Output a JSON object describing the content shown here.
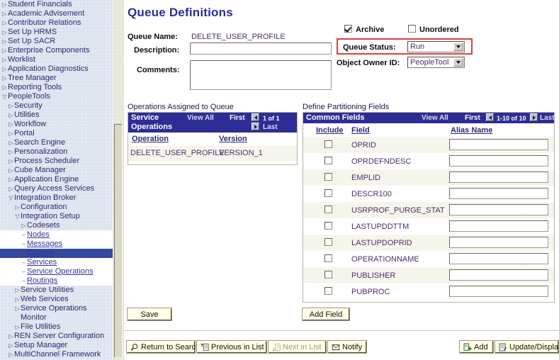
{
  "sidebar": {
    "items": [
      {
        "label": "Student Financials",
        "type": "collapsed",
        "indent": 0
      },
      {
        "label": "Academic Advisement",
        "type": "collapsed",
        "indent": 0
      },
      {
        "label": "Contributor Relations",
        "type": "collapsed",
        "indent": 0
      },
      {
        "label": "Set Up HRMS",
        "type": "collapsed",
        "indent": 0
      },
      {
        "label": "Set Up SACR",
        "type": "collapsed",
        "indent": 0
      },
      {
        "label": "Enterprise Components",
        "type": "collapsed",
        "indent": 0
      },
      {
        "label": "Worklist",
        "type": "collapsed",
        "indent": 0
      },
      {
        "label": "Application Diagnostics",
        "type": "collapsed",
        "indent": 0
      },
      {
        "label": "Tree Manager",
        "type": "collapsed",
        "indent": 0
      },
      {
        "label": "Reporting Tools",
        "type": "collapsed",
        "indent": 0
      },
      {
        "label": "PeopleTools",
        "type": "expanded",
        "indent": 0
      },
      {
        "label": "Security",
        "type": "collapsed",
        "indent": 1
      },
      {
        "label": "Utilities",
        "type": "collapsed",
        "indent": 1
      },
      {
        "label": "Workflow",
        "type": "collapsed",
        "indent": 1
      },
      {
        "label": "Portal",
        "type": "collapsed",
        "indent": 1
      },
      {
        "label": "Search Engine",
        "type": "collapsed",
        "indent": 1
      },
      {
        "label": "Personalization",
        "type": "collapsed",
        "indent": 1
      },
      {
        "label": "Process Scheduler",
        "type": "collapsed",
        "indent": 1
      },
      {
        "label": "Cube Manager",
        "type": "collapsed",
        "indent": 1
      },
      {
        "label": "Application Engine",
        "type": "collapsed",
        "indent": 1
      },
      {
        "label": "Query Access Services",
        "type": "collapsed",
        "indent": 1
      },
      {
        "label": "Integration Broker",
        "type": "expanded",
        "indent": 1
      },
      {
        "label": "Configuration",
        "type": "collapsed",
        "indent": 2
      },
      {
        "label": "Integration Setup",
        "type": "expanded",
        "indent": 2
      },
      {
        "label": "Codesets",
        "type": "collapsed",
        "indent": 3
      },
      {
        "label": "Nodes",
        "type": "link",
        "indent": 3
      },
      {
        "label": "Messages",
        "type": "link",
        "indent": 3
      },
      {
        "label": "Queues",
        "type": "link-selected",
        "indent": 3
      },
      {
        "label": "Services",
        "type": "link",
        "indent": 3
      },
      {
        "label": "Service Operations",
        "type": "link",
        "indent": 3
      },
      {
        "label": "Routings",
        "type": "link",
        "indent": 3
      },
      {
        "label": "Service Utilities",
        "type": "collapsed",
        "indent": 2
      },
      {
        "label": "Web Services",
        "type": "collapsed",
        "indent": 2
      },
      {
        "label": "Service Operations",
        "type": "collapsed",
        "indent": 2
      },
      {
        "label": "Monitor",
        "type": "plain",
        "indent": 2
      },
      {
        "label": "File Utilities",
        "type": "collapsed",
        "indent": 2
      },
      {
        "label": "REN Server Configuration",
        "type": "collapsed",
        "indent": 1
      },
      {
        "label": "Setup Manager",
        "type": "collapsed",
        "indent": 1
      },
      {
        "label": "MultiChannel Framework",
        "type": "collapsed",
        "indent": 1
      }
    ]
  },
  "page": {
    "title": "Queue Definitions"
  },
  "form": {
    "queue_name_label": "Queue Name:",
    "queue_name_value": "DELETE_USER_PROFILE",
    "description_label": "Description:",
    "description_value": "",
    "description_placeholder": "",
    "comments_label": "Comments:",
    "comments_value": "",
    "archive_label": "Archive",
    "archive_checked": true,
    "unordered_label": "Unordered",
    "unordered_checked": false,
    "queue_status_label": "Queue Status:",
    "queue_status_value": "Run",
    "object_owner_label": "Object Owner ID:",
    "object_owner_value": "PeopleTool",
    "highlight_color": "#d94141"
  },
  "operations_grid": {
    "caption": "Operations Assigned to Queue",
    "header_title_line1": "Service",
    "header_title_line2": "Operations",
    "view_all": "View All",
    "first": "First",
    "count": "1 of 1",
    "last": "Last",
    "prev_icon": "left-triangle-icon",
    "next_icon": "right-triangle-icon",
    "columns": [
      "Operation",
      "Version"
    ],
    "rows": [
      {
        "operation": "DELETE_USER_PROFILE",
        "version": "VERSION_1"
      }
    ]
  },
  "partitioning_grid": {
    "caption": "Define Partitioning Fields",
    "header_title": "Common Fields",
    "view_all": "View All",
    "first": "First",
    "count": "1-10 of 10",
    "last": "Last",
    "prev_icon": "left-triangle-icon",
    "next_icon": "right-triangle-icon",
    "columns": [
      "Include",
      "Field",
      "Alias Name"
    ],
    "rows": [
      {
        "include": false,
        "field": "OPRID",
        "alias": ""
      },
      {
        "include": false,
        "field": "OPRDEFNDESC",
        "alias": ""
      },
      {
        "include": false,
        "field": "EMPLID",
        "alias": ""
      },
      {
        "include": false,
        "field": "DESCR100",
        "alias": ""
      },
      {
        "include": false,
        "field": "USRPROF_PURGE_STAT",
        "alias": ""
      },
      {
        "include": false,
        "field": "LASTUPDDTTM",
        "alias": ""
      },
      {
        "include": false,
        "field": "LASTUPDOPRID",
        "alias": ""
      },
      {
        "include": false,
        "field": "OPERATIONNAME",
        "alias": ""
      },
      {
        "include": false,
        "field": "PUBLISHER",
        "alias": ""
      },
      {
        "include": false,
        "field": "PUBPROC",
        "alias": ""
      }
    ]
  },
  "actions": {
    "save": "Save",
    "add_field": "Add Field",
    "return_to_search": "Return to Search",
    "previous_in_list": "Previous in List",
    "next_in_list": "Next in List",
    "notify": "Notify",
    "add": "Add",
    "update_display": "Update/Display",
    "icons": {
      "return_to_search": "magnifier-icon",
      "previous_in_list": "up-list-icon",
      "next_in_list": "down-list-icon",
      "notify": "envelope-icon",
      "add": "add-page-icon",
      "update_display": "update-page-icon"
    }
  }
}
